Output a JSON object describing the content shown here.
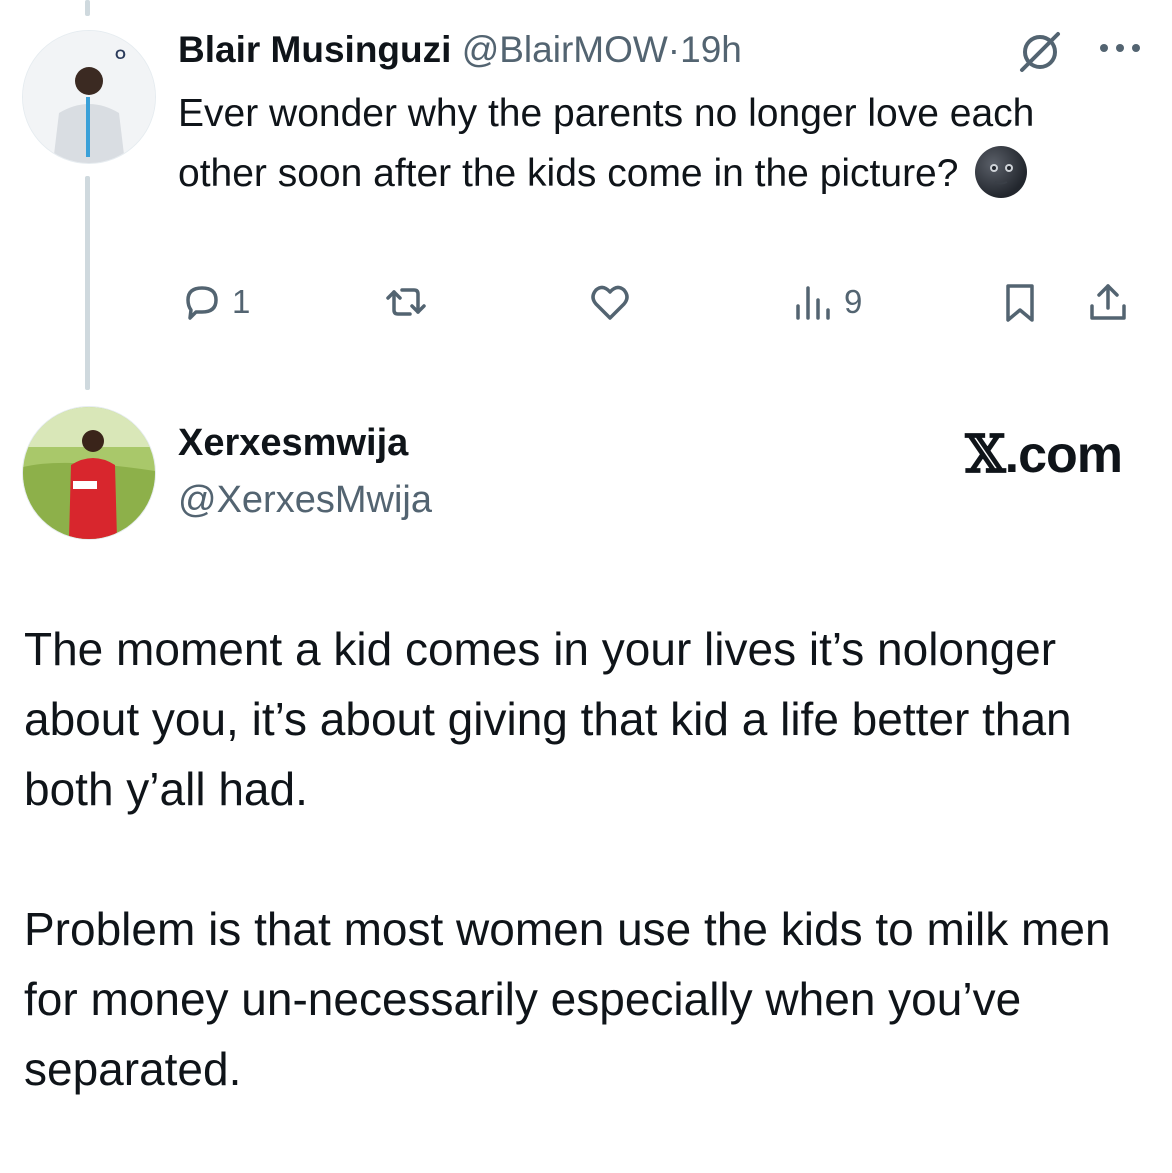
{
  "original_tweet": {
    "display_name": "Blair Musinguzi",
    "handle": "@BlairMOW",
    "separator": "·",
    "time": "19h",
    "text": "Ever wonder why the parents no longer love each other soon after the kids come in the picture?",
    "emoji": "new-moon-face",
    "actions": {
      "reply_count": "1",
      "repost_count": "",
      "like_count": "",
      "view_count": "9"
    },
    "icons": [
      "grok-icon",
      "more-icon",
      "reply-icon",
      "repost-icon",
      "like-icon",
      "views-icon",
      "bookmark-icon",
      "share-icon"
    ]
  },
  "reply": {
    "display_name": "Xerxesmwija",
    "handle": "@XerxesMwija",
    "paragraphs": [
      "The moment a kid comes in your lives it’s nolonger about you, it’s about giving that kid a life better than both y’all had.",
      "Problem is that most women use the kids to milk men for money un-necessarily especially when you’ve separated."
    ]
  },
  "watermark": {
    "logo": "𝕏",
    "suffix": ".com"
  },
  "colors": {
    "text": "#0f1419",
    "secondary": "#536471",
    "thread_line": "#cfd9de",
    "background": "#ffffff"
  }
}
